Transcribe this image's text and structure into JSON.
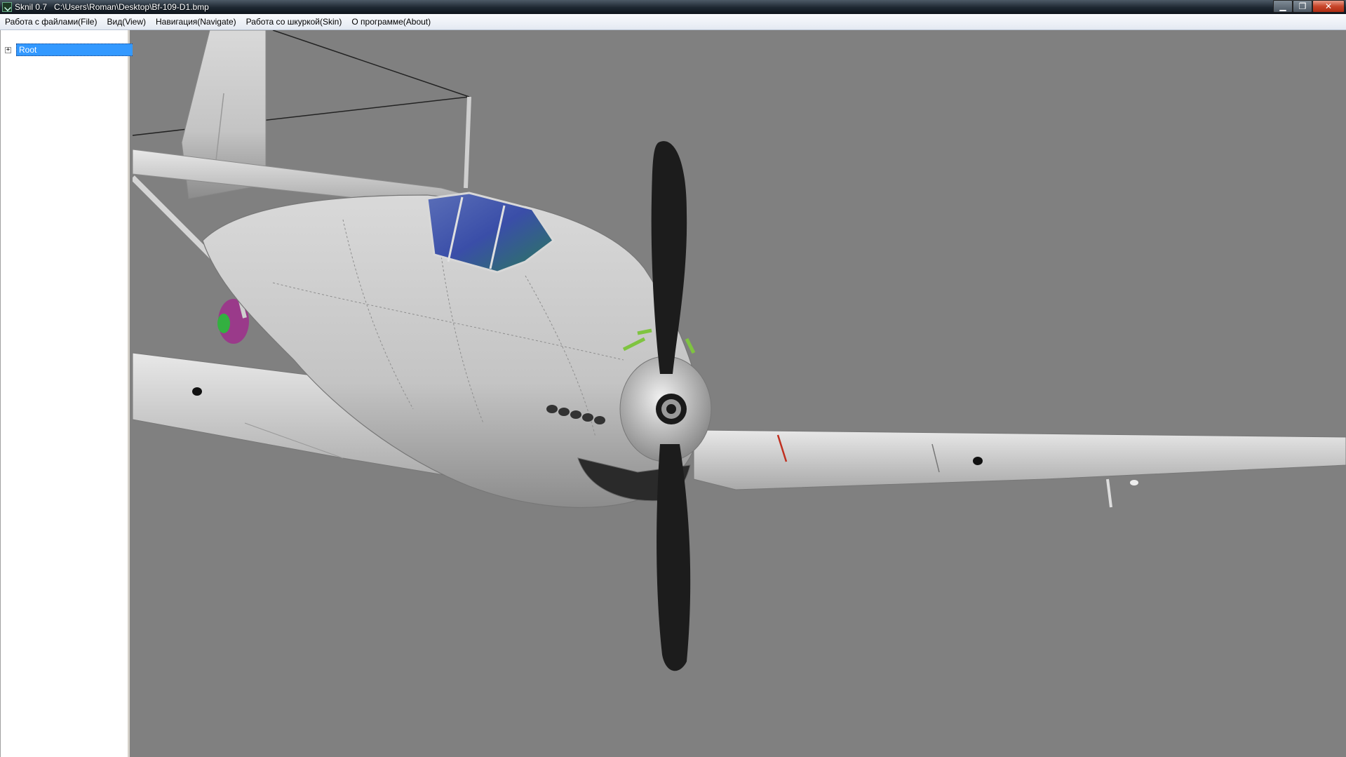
{
  "window": {
    "app_name": "Sknil 0.7",
    "file_path": "C:\\Users\\Roman\\Desktop\\Bf-109-D1.bmp",
    "controls": {
      "minimize_icon": "minimize-icon",
      "maximize_icon": "restore-icon",
      "close_icon": "close-icon"
    }
  },
  "menu": {
    "items": [
      "Работа с файлами(File)",
      "Вид(View)",
      "Навигация(Navigate)",
      "Работа со шкуркой(Skin)",
      "О программе(About)"
    ]
  },
  "tree": {
    "root": {
      "expander": "+",
      "label": "Root"
    },
    "selection_color": "#3399ff"
  },
  "viewport": {
    "background_color": "#808080",
    "scene": "3d-model-render"
  }
}
